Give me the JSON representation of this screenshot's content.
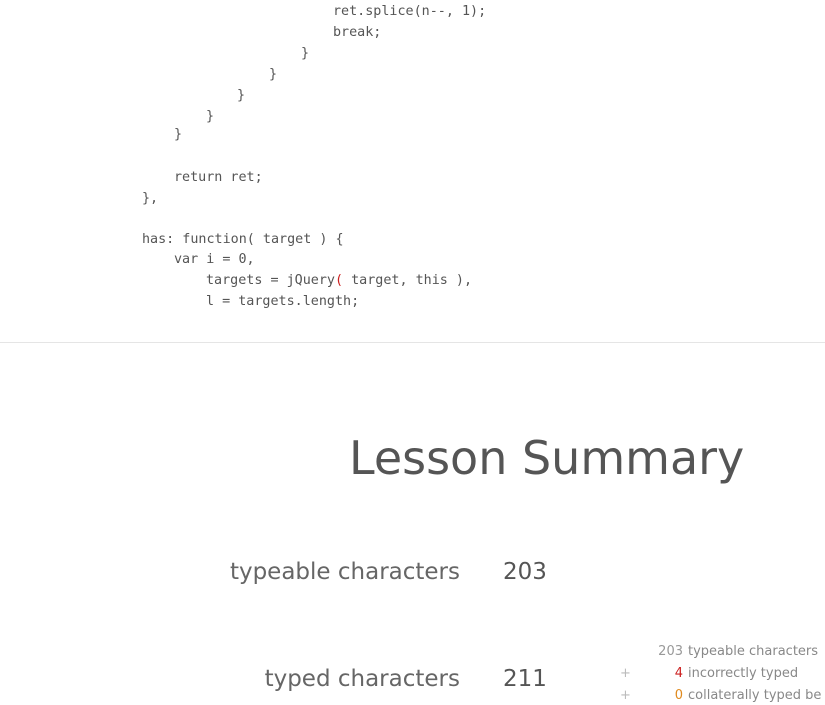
{
  "code": {
    "lines": [
      {
        "indent": "                    ",
        "text": "ret.splice(n--, 1);"
      },
      {
        "indent": "                    ",
        "text": "break;"
      },
      {
        "indent": "                ",
        "text": "}"
      },
      {
        "indent": "            ",
        "text": "}"
      },
      {
        "indent": "        ",
        "text": "}"
      },
      {
        "indent": "    ",
        "text": "}"
      },
      {
        "indent": "",
        "text": "}"
      },
      {
        "indent": "",
        "text": ""
      },
      {
        "indent": "",
        "text": "return ret;"
      },
      {
        "indent": "",
        "text": "},"
      },
      {
        "indent": "",
        "text": ""
      },
      {
        "indent": "",
        "text": "has: function( target ) {"
      },
      {
        "indent": "",
        "text": "var i = 0,"
      },
      {
        "indent": "",
        "text": "targets = jQuery( target, this ),"
      },
      {
        "indent": "",
        "text": "l = targets.length;"
      }
    ],
    "highlight": {
      "line_index": 13,
      "before": "targets = jQuery",
      "char": "(",
      "after": " target, this ),"
    }
  },
  "summary": {
    "title": "Lesson Summary",
    "typeable_label": "typeable characters",
    "typeable_value": "203",
    "typed_label": "typed characters",
    "typed_value": "211"
  },
  "breakdown": [
    {
      "op": "",
      "value": "203",
      "label": "typeable characters",
      "color": "#999999"
    },
    {
      "op": "+",
      "value": "4",
      "label": "incorrectly typed",
      "color": "#cc1f1f"
    },
    {
      "op": "+",
      "value": "0",
      "label": "collaterally typed be",
      "color": "#e08a1e"
    }
  ],
  "colors": {
    "code_text": "#555555",
    "cursor_error": "#cc1f1f",
    "divider": "#e5e5e5",
    "title": "#555555"
  }
}
